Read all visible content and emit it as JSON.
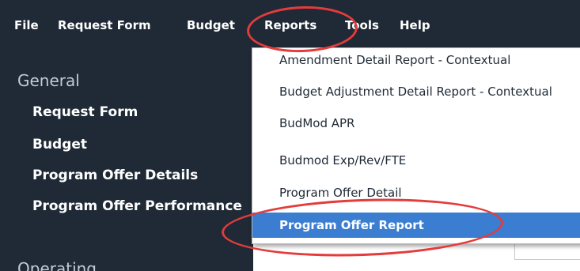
{
  "menubar": {
    "items": [
      "File",
      "Request Form",
      "Budget",
      "Reports",
      "Tools",
      "Help"
    ]
  },
  "sidebar": {
    "sections": [
      {
        "title": "General",
        "items": [
          "Request Form",
          "Budget",
          "Program Offer Details",
          "Program Offer Performance"
        ]
      },
      {
        "title": "Operating",
        "items": []
      }
    ]
  },
  "reports_menu": {
    "items": [
      "Amendment Detail Report - Contextual",
      "Budget Adjustment Detail Report - Contextual",
      "BudMod APR",
      "Budmod Exp/Rev/FTE",
      "Program Offer Detail",
      "Program Offer Report"
    ],
    "selected": "Program Offer Report"
  },
  "colors": {
    "sidebar_bg": "#1f2a36",
    "highlight": "#3b7dd0",
    "annotation": "#e43b3b"
  }
}
